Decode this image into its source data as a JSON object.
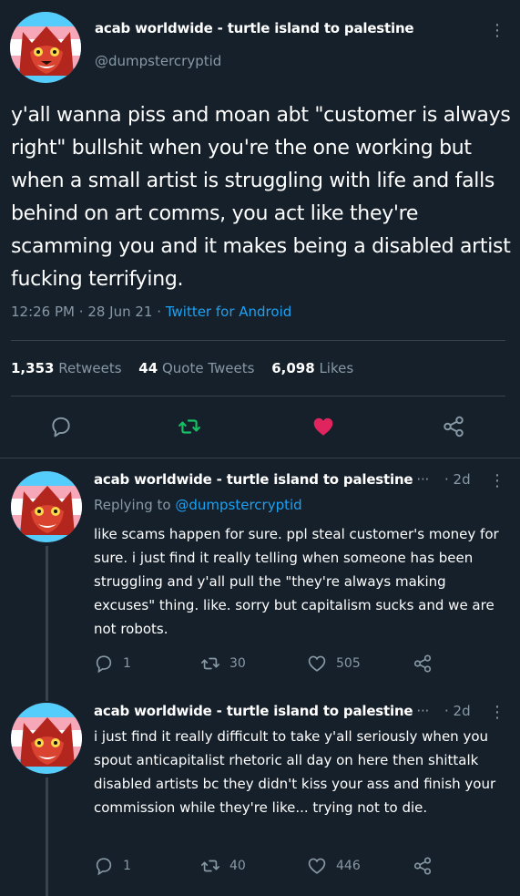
{
  "main_tweet": {
    "name": "acab worldwide - turtle island to palestine",
    "handle": "@dumpstercryptid",
    "text": "y'all wanna piss and moan abt \"customer is always right\" bullshit when you're the one working but when a small artist is struggling with life and falls behind on art comms, you act like they're scamming you and it makes being a disabled artist fucking terrifying.",
    "time": "12:26 PM",
    "date": "28 Jun 21",
    "source": "Twitter for Android",
    "separator": "·",
    "stats": {
      "retweets_count": "1,353",
      "retweets_label": "Retweets",
      "quotes_count": "44",
      "quotes_label": "Quote Tweets",
      "likes_count": "6,098",
      "likes_label": "Likes"
    },
    "more_glyph": "⋮"
  },
  "replies": [
    {
      "name": "acab worldwide - turtle island to palestine",
      "name_overflow": "···",
      "time": "· 2d",
      "replying_prefix": "Replying to",
      "replying_handle": "@dumpstercryptid",
      "text": "like scams happen for sure. ppl steal customer's money for sure. i just find it really telling when someone has been struggling and y'all pull the \"they're always making excuses\" thing. like. sorry but capitalism sucks and we are not robots.",
      "reply_count": "1",
      "retweet_count": "30",
      "like_count": "505"
    },
    {
      "name": "acab worldwide - turtle island to palestine",
      "name_overflow": "···",
      "time": "· 2d",
      "text": "i just find it really difficult to take y'all seriously when you spout anticapitalist rhetoric all day on here then shittalk disabled artists bc they didn't kiss your ass and finish your commission while they're like... trying not to die.",
      "reply_count": "1",
      "retweet_count": "40",
      "like_count": "446"
    }
  ],
  "colors": {
    "background": "#15202b",
    "secondary_text": "#8899a6",
    "link": "#1da1f2",
    "retweet_green": "#17bf63",
    "like_pink": "#e0245e",
    "divider": "#38444d"
  },
  "icons": [
    "avatar",
    "more-vertical-icon",
    "reply-icon",
    "retweet-icon",
    "heart-icon",
    "share-icon"
  ]
}
